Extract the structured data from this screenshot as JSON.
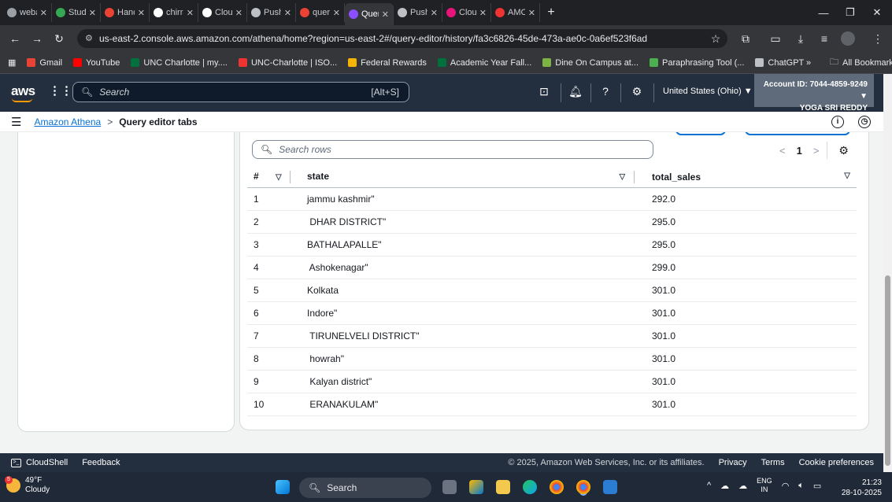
{
  "browser": {
    "tabs": [
      {
        "label": "webaut",
        "color": "#9aa0a6"
      },
      {
        "label": "Studen",
        "color": "#34a853"
      },
      {
        "label": "Hands",
        "color": "#ea4335"
      },
      {
        "label": "chirradi",
        "color": "#ffffff"
      },
      {
        "label": "CloudA",
        "color": "#ffffff"
      },
      {
        "label": "Push fo",
        "color": "#bdc1c6"
      },
      {
        "label": "querie",
        "color": "#ea4335"
      },
      {
        "label": "Query",
        "color": "#8c4fff",
        "active": true
      },
      {
        "label": "Push fo",
        "color": "#bdc1c6"
      },
      {
        "label": "CloudV",
        "color": "#e7157b"
      },
      {
        "label": "AMC S",
        "color": "#e33"
      }
    ],
    "new_tab": "+",
    "url": "us-east-2.console.aws.amazon.com/athena/home?region=us-east-2#/query-editor/history/fa3c6826-45de-473a-ae0c-0a6ef523f6ad",
    "bookmarks": [
      {
        "label": "Gmail",
        "color": "#ea4335"
      },
      {
        "label": "YouTube",
        "color": "#ff0000"
      },
      {
        "label": "UNC Charlotte | my....",
        "color": "#00703c"
      },
      {
        "label": "UNC-Charlotte | ISO...",
        "color": "#e33"
      },
      {
        "label": "Federal Rewards",
        "color": "#f4b400"
      },
      {
        "label": "Academic Year Fall...",
        "color": "#00703c"
      },
      {
        "label": "Dine On Campus at...",
        "color": "#7cb342"
      },
      {
        "label": "Paraphrasing Tool (...",
        "color": "#4caf50"
      },
      {
        "label": "ChatGPT",
        "color": "#bdc1c6"
      }
    ],
    "all_bookmarks": "All Bookmarks",
    "overflow": "»"
  },
  "aws": {
    "logo": "aws",
    "search_placeholder": "Search",
    "search_shortcut": "[Alt+S]",
    "region": "United States (Ohio) ▼",
    "account_id": "Account ID: 7044-4859-9249 ▼",
    "user": "YOGA SRI REDDY"
  },
  "breadcrumb": {
    "root": "Amazon Athena",
    "separator": ">",
    "current": "Query editor tabs"
  },
  "results": {
    "search_placeholder": "Search rows",
    "page": "1",
    "columns": [
      "#",
      "state",
      "total_sales"
    ],
    "rows": [
      {
        "num": "1",
        "state": "jammu kashmir\"",
        "total_sales": "292.0"
      },
      {
        "num": "2",
        "state": " DHAR DISTRICT\"",
        "total_sales": "295.0"
      },
      {
        "num": "3",
        "state": "BATHALAPALLE\"",
        "total_sales": "295.0"
      },
      {
        "num": "4",
        "state": " Ashokenagar\"",
        "total_sales": "299.0"
      },
      {
        "num": "5",
        "state": "Kolkata",
        "total_sales": "301.0"
      },
      {
        "num": "6",
        "state": "Indore\"",
        "total_sales": "301.0"
      },
      {
        "num": "7",
        "state": " TIRUNELVELI DISTRICT\"",
        "total_sales": "301.0"
      },
      {
        "num": "8",
        "state": " howrah\"",
        "total_sales": "301.0"
      },
      {
        "num": "9",
        "state": " Kalyan district\"",
        "total_sales": "301.0"
      },
      {
        "num": "10",
        "state": " ERANAKULAM\"",
        "total_sales": "301.0"
      }
    ]
  },
  "footer": {
    "cloudshell": "CloudShell",
    "feedback": "Feedback",
    "copyright": "© 2025, Amazon Web Services, Inc. or its affiliates.",
    "privacy": "Privacy",
    "terms": "Terms",
    "cookies": "Cookie preferences"
  },
  "taskbar": {
    "notification_count": "5",
    "temperature": "49°F",
    "condition": "Cloudy",
    "search": "Search",
    "lang": "ENG",
    "lang_sub": "IN",
    "time": "21:23",
    "date": "28-10-2025"
  }
}
